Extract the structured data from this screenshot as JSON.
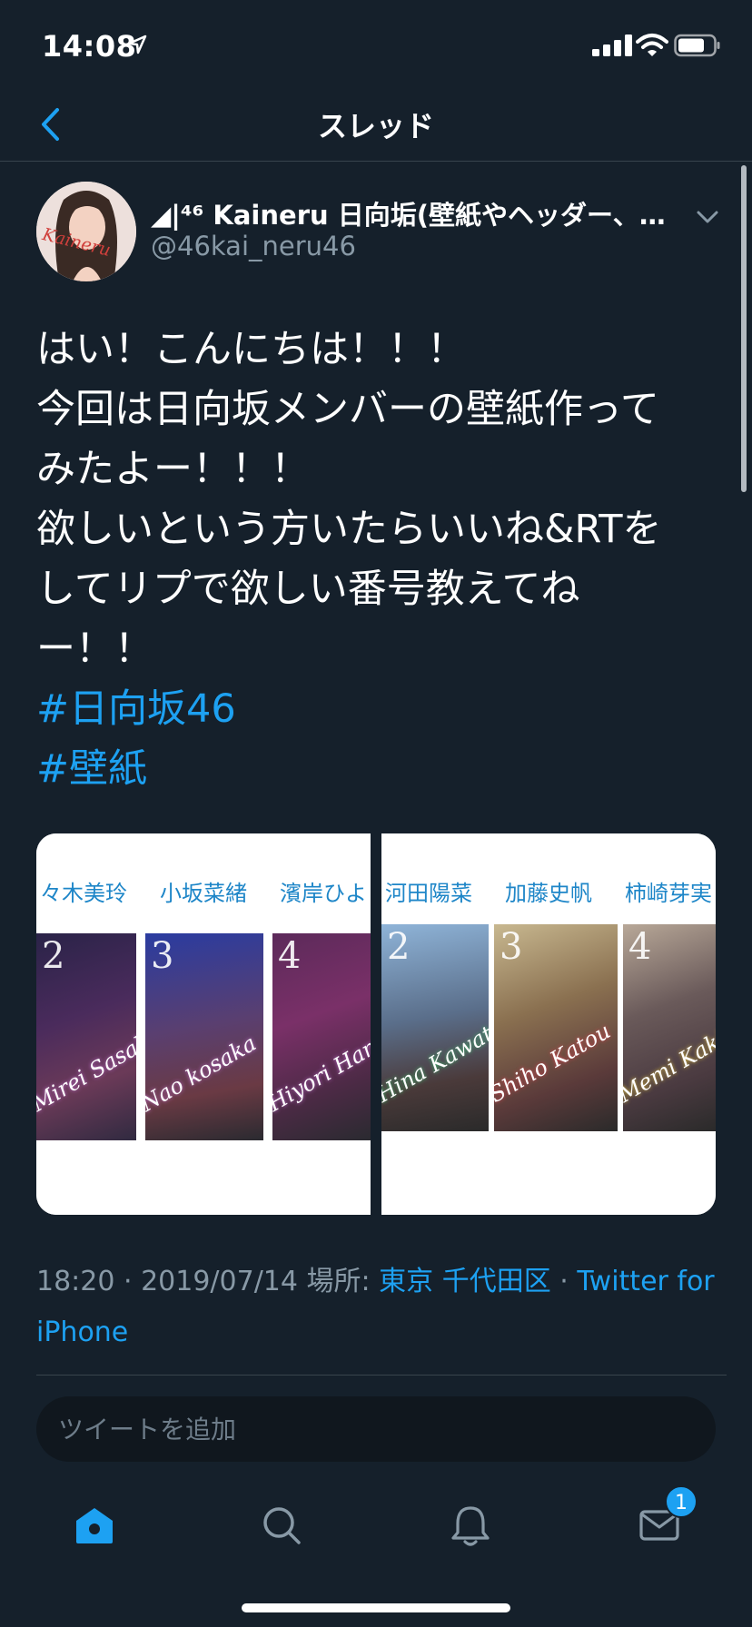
{
  "status_bar": {
    "time": "14:08"
  },
  "nav": {
    "title": "スレッド"
  },
  "tweet": {
    "display_name": "◢|⁴⁶ Kaineru 日向垢(壁紙やヘッダー、…",
    "handle": "@46kai_neru46",
    "avatar_text": "Kaineru",
    "text_lines": [
      "はい！こんにちは！！！",
      "今回は日向坂メンバーの壁紙作って",
      "みたよー！！！",
      "欲しいという方いたらいいね&RTを",
      "してリプで欲しい番号教えてね",
      "ー！！"
    ],
    "hashtags": [
      "#日向坂46",
      "#壁紙"
    ],
    "media": {
      "left": {
        "names": [
          "々木美玲",
          "小坂菜緒",
          "濱岸ひよ"
        ],
        "numbers": [
          "2",
          "3",
          "4"
        ],
        "signatures": [
          "Mirei Sasaki",
          "Nao kosaka",
          "Hiyori Hamagish"
        ]
      },
      "right": {
        "names": [
          "河田陽菜",
          "加藤史帆",
          "柿崎芽実"
        ],
        "numbers": [
          "2",
          "3",
          "4"
        ],
        "signatures": [
          "Hina Kawata",
          "Shiho Katou",
          "Memi Kakiz"
        ]
      }
    },
    "meta": {
      "time": "18:20 · 2019/07/14 場所: ",
      "location": "東京 千代田区",
      "separator": " · ",
      "source": "Twitter for iPhone"
    }
  },
  "reply": {
    "placeholder": "ツイートを追加"
  },
  "tabbar": {
    "messages_badge": "1"
  },
  "colors": {
    "background": "#15202b",
    "accent": "#1da1f2",
    "muted": "#8899a6"
  }
}
